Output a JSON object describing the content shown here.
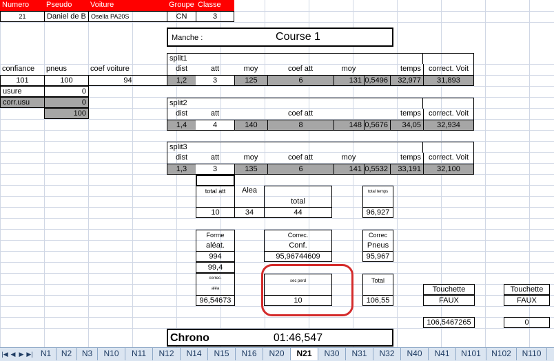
{
  "sheet": {
    "header": {
      "numero_label": "Numero",
      "pseudo_label": "Pseudo",
      "voiture_label": "Voiture",
      "groupe_label": "Groupe",
      "classe_label": "Classe",
      "numero": "21",
      "pseudo": "Daniel de B",
      "voiture": "Osella PA20S",
      "groupe": "CN",
      "classe": "3"
    },
    "manche": {
      "label": "Manche :",
      "value": "Course 1"
    },
    "left": {
      "confiance_label": "confiance",
      "pneus_label": "pneus",
      "coef_label": "coef voiture",
      "confiance": "101",
      "pneus": "100",
      "coef": "94",
      "usure_label": "usure",
      "usure": "0",
      "corr_label": "corr.usu",
      "corr": "0",
      "total": "100"
    },
    "splits": [
      {
        "title": "split1",
        "dist": "1,2",
        "att": "3",
        "moy1": "125",
        "coef_att": "6",
        "moy2": "131",
        "ratio": "0,5496",
        "temps": "32,977",
        "correct": "31,893"
      },
      {
        "title": "split2",
        "dist": "1,4",
        "att": "4",
        "moy1": "140",
        "coef_att": "8",
        "moy2": "148",
        "ratio": "0,5676",
        "temps": "34,05",
        "correct": "32,934"
      },
      {
        "title": "split3",
        "dist": "1,3",
        "att": "3",
        "moy1": "135",
        "coef_att": "6",
        "moy2": "141",
        "ratio": "0,5532",
        "temps": "33,191",
        "correct": "32,100"
      }
    ],
    "split_headers": {
      "dist": "dist",
      "att": "att",
      "moy": "moy",
      "coef_att": "coef att",
      "temps": "temps",
      "correct": "correct. Voit"
    },
    "totals": {
      "total_att_label": "total att",
      "alea_label": "Alea",
      "total_label": "total",
      "total_att": "10",
      "alea": "34",
      "total": "44",
      "total_temps_label": "total temps",
      "total_temps": "96,927"
    },
    "forme": {
      "label1": "Forme",
      "label2": "aléat.",
      "v1": "994",
      "v2": "99,4",
      "correc_label1": "correc.",
      "correc_label2": "aléa",
      "correc": "96,54673"
    },
    "conf": {
      "label1": "Correc.",
      "label2": "Conf.",
      "value": "95,96744609"
    },
    "pneus": {
      "label1": "Correc",
      "label2": "Pneus",
      "value": "95,967"
    },
    "sec_perd": {
      "label": "sec perd",
      "value": "10"
    },
    "total_box": {
      "label": "Total",
      "value": "106,55"
    },
    "touchette1": {
      "label": "Touchette",
      "value": "FAUX"
    },
    "touchette2": {
      "label": "Touchette",
      "value": "FAUX"
    },
    "final1": "106,5467265",
    "final2": "0",
    "chrono": {
      "label": "Chrono",
      "value": "01:46,547"
    }
  },
  "tabs": [
    "N1",
    "N2",
    "N3",
    "N10",
    "N11",
    "N12",
    "N14",
    "N15",
    "N16",
    "N20",
    "N21",
    "N30",
    "N31",
    "N32",
    "N40",
    "N41",
    "N101",
    "N102",
    "N110"
  ],
  "active_tab": "N21",
  "colors": {
    "header_red": "#ff0000",
    "gray_fill": "#a6a6a6",
    "circle": "#d42b2b"
  }
}
